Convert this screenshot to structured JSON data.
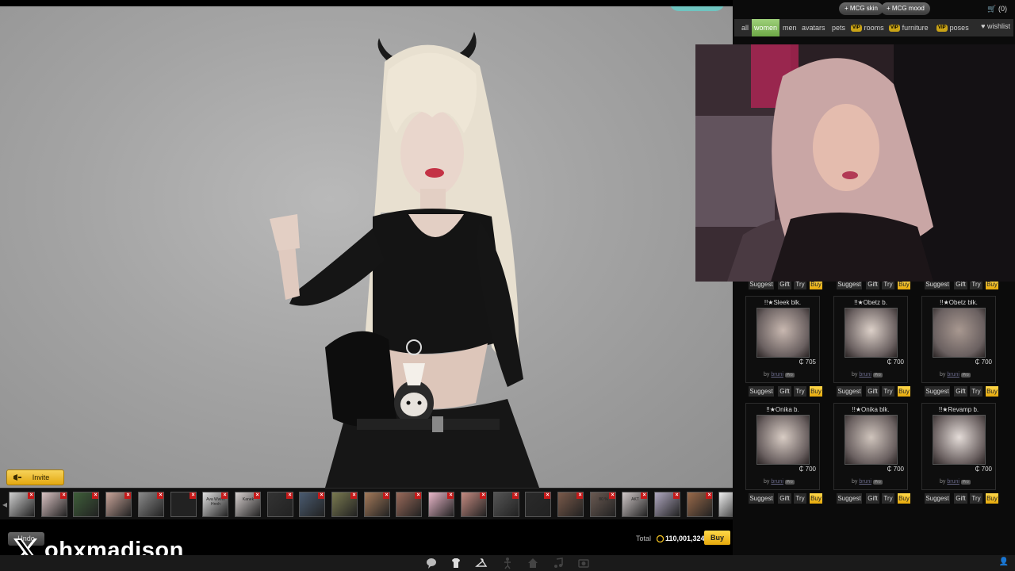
{
  "cart": {
    "invite_label": "Invite",
    "undo_label": "Undo",
    "total_label": "Total",
    "total_value": "110,001,324",
    "buy_label": "Buy"
  },
  "watermark": {
    "handle": "ohxmadison"
  },
  "shop": {
    "top_buttons": [
      "+ MCG skin",
      "+ MCG mood"
    ],
    "cart_count": "(0)",
    "tabs": [
      {
        "label": "all",
        "vip": false
      },
      {
        "label": "women",
        "vip": false
      },
      {
        "label": "men",
        "vip": false
      },
      {
        "label": "avatars",
        "vip": false
      },
      {
        "label": "pets",
        "vip": false
      },
      {
        "label": "rooms",
        "vip": true
      },
      {
        "label": "furniture",
        "vip": true
      },
      {
        "label": "poses",
        "vip": true
      }
    ],
    "vip_tag": "VIP",
    "wishlist_label": "wishlist",
    "action_labels": {
      "suggest": "Suggest",
      "gift": "Gift",
      "try": "Try",
      "buy": "Buy"
    },
    "by_label": "by",
    "products": [
      {
        "name": "!!★Sleek blk.",
        "price": "705",
        "creator": "bruni",
        "tag": "Pro"
      },
      {
        "name": "!!★Obetz b.",
        "price": "700",
        "creator": "bruni",
        "tag": "Pro"
      },
      {
        "name": "!!★Obetz blk.",
        "price": "700",
        "creator": "bruni",
        "tag": "Pro"
      },
      {
        "name": "!!★Onika b.",
        "price": "700",
        "creator": "bruni",
        "tag": "Pro"
      },
      {
        "name": "!!★Onika blk.",
        "price": "700",
        "creator": "bruni",
        "tag": "Pro"
      },
      {
        "name": "!!★Revamp b.",
        "price": "700",
        "creator": "bruni",
        "tag": "Pro"
      }
    ]
  },
  "colors": {
    "accent_vip": "#c9a316",
    "buy_yellow": "#ffd84a",
    "women_tab_green": "#7cb955",
    "remove_red": "#c61a1a"
  },
  "cart_thumb_colors": [
    "#cfcfcf",
    "#d9c2c2",
    "#3f5f3a",
    "#c9a59a",
    "#8a8a8a",
    "#222",
    "#e0e0e0",
    "#d7d0cf",
    "#333",
    "#4a5b70",
    "#7a7a50",
    "#a47a5a",
    "#9a6a5a",
    "#e9b7c9",
    "#c48a80",
    "#555",
    "#2a2a2a",
    "#7a5a4a",
    "#6a5a52",
    "#d0c8c8",
    "#b0a8c0",
    "#9a6a4a",
    "#eee"
  ],
  "cart_thumb_texts": {
    "6": "Ava Wwhh Hnnh",
    "7": "Kanek",
    "18": "80 %",
    "19": "AKT"
  }
}
